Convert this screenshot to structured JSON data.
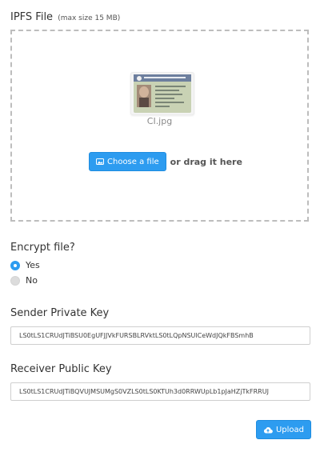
{
  "file_section": {
    "label": "IPFS File",
    "hint": "(max size 15 MB)",
    "file_name": "CI.jpg",
    "choose_label": "Choose a file",
    "drag_label": "or drag it here",
    "thumbnail_icon": "id-card-image"
  },
  "encrypt_section": {
    "label": "Encrypt file?",
    "options": [
      {
        "label": "Yes",
        "selected": true
      },
      {
        "label": "No",
        "selected": false
      }
    ]
  },
  "sender_key": {
    "label": "Sender Private Key",
    "value": "LS0tLS1CRUdJTiBSU0EgUFJJVkFURSBLRVktLS0tLQpNSUlCeWdJQkFBSmhB"
  },
  "receiver_key": {
    "label": "Receiver Public Key",
    "value": "LS0tLS1CRUdJTiBQVUJMSUMgS0VZLS0tLS0KTUh3d0RRWUpLb1pJaHZjTkFRRUJ"
  },
  "upload": {
    "label": "Upload",
    "icon": "cloud-upload-icon"
  },
  "colors": {
    "accent": "#2d9cf0",
    "dropzone_border": "#bdbdbd"
  }
}
